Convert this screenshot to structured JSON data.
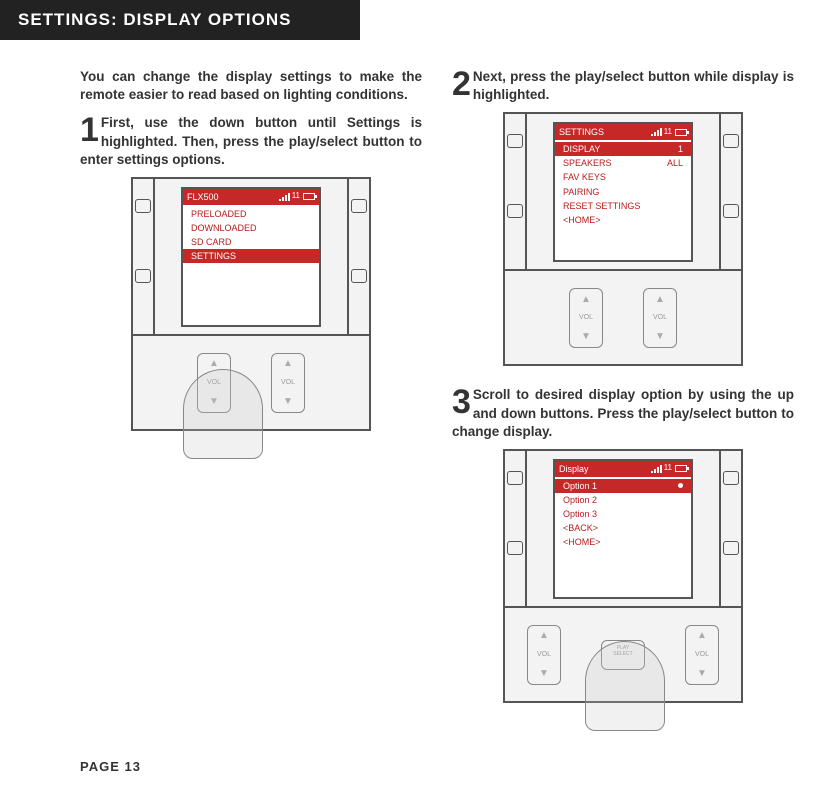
{
  "header": "SETTINGS: DISPLAY OPTIONS",
  "intro": "You can change the display settings to make the remote easier to read based on lighting conditions.",
  "step1": {
    "num": "1",
    "text": "First, use the down button until Settings is highlighted. Then, press the play/select button to enter settings options.",
    "screen_title": "FLX500",
    "status_num": "11",
    "menu": [
      "PRELOADED",
      "DOWNLOADED",
      "SD CARD"
    ],
    "menu_hl": "SETTINGS"
  },
  "step2": {
    "num": "2",
    "text": "Next, press the play/select button while display is highlighted.",
    "screen_title": "SETTINGS",
    "status_num": "11",
    "hl_label": "DISPLAY",
    "hl_value": "1",
    "rows": [
      {
        "label": "SPEAKERS",
        "value": "ALL"
      },
      {
        "label": "FAV KEYS",
        "value": ""
      },
      {
        "label": "PAIRING",
        "value": ""
      },
      {
        "label": "RESET SETTINGS",
        "value": ""
      },
      {
        "label": "<HOME>",
        "value": ""
      }
    ]
  },
  "step3": {
    "num": "3",
    "text": "Scroll to desired display option by using the up and down buttons. Press the play/select button to change display.",
    "screen_title": "Display",
    "status_num": "11",
    "hl_label": "Option 1",
    "rows": [
      "Option 2",
      "Option 3",
      "<BACK>",
      "<HOME>"
    ]
  },
  "vol_label": "VOL",
  "play_label": "PLAY",
  "select_label": "SELECT",
  "page": "PAGE 13"
}
